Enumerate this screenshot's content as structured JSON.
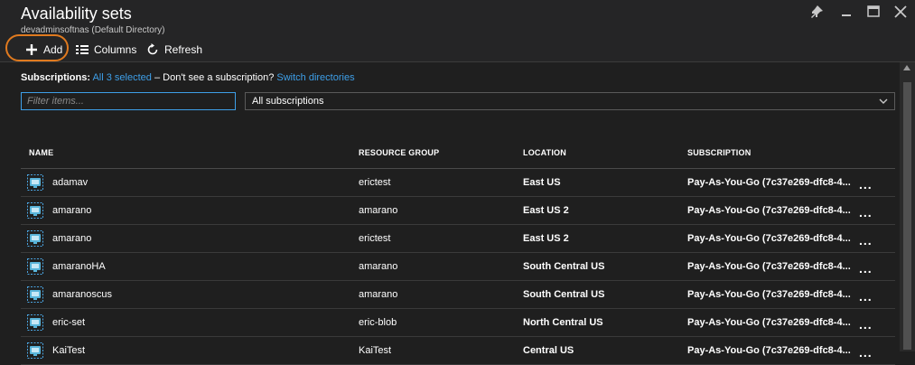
{
  "blade": {
    "title": "Availability sets",
    "subtitle": "devadminsoftnas (Default Directory)"
  },
  "window_controls": [
    {
      "name": "pin-icon"
    },
    {
      "name": "minimize-icon"
    },
    {
      "name": "maximize-icon"
    },
    {
      "name": "close-icon"
    }
  ],
  "toolbar": {
    "add_label": "Add",
    "columns_label": "Columns",
    "refresh_label": "Refresh",
    "highlight_color": "#e07a1f"
  },
  "subscriptions": {
    "label": "Subscriptions:",
    "selected_link": "All 3 selected",
    "prompt": "– Don't see a subscription?",
    "switch_link": "Switch directories"
  },
  "filter": {
    "placeholder": "Filter items...",
    "value": ""
  },
  "subscription_select": {
    "selected": "All subscriptions"
  },
  "table": {
    "columns": [
      "NAME",
      "RESOURCE GROUP",
      "LOCATION",
      "SUBSCRIPTION"
    ],
    "rows": [
      {
        "name": "adamav",
        "resource_group": "erictest",
        "location": "East US",
        "subscription": "Pay-As-You-Go (7c37e269-dfc8-4..."
      },
      {
        "name": "amarano",
        "resource_group": "amarano",
        "location": "East US 2",
        "subscription": "Pay-As-You-Go (7c37e269-dfc8-4..."
      },
      {
        "name": "amarano",
        "resource_group": "erictest",
        "location": "East US 2",
        "subscription": "Pay-As-You-Go (7c37e269-dfc8-4..."
      },
      {
        "name": "amaranoHA",
        "resource_group": "amarano",
        "location": "South Central US",
        "subscription": "Pay-As-You-Go (7c37e269-dfc8-4..."
      },
      {
        "name": "amaranoscus",
        "resource_group": "amarano",
        "location": "South Central US",
        "subscription": "Pay-As-You-Go (7c37e269-dfc8-4..."
      },
      {
        "name": "eric-set",
        "resource_group": "eric-blob",
        "location": "North Central US",
        "subscription": "Pay-As-You-Go (7c37e269-dfc8-4..."
      },
      {
        "name": "KaiTest",
        "resource_group": "KaiTest",
        "location": "Central US",
        "subscription": "Pay-As-You-Go (7c37e269-dfc8-4..."
      }
    ],
    "more_label": "...",
    "row_icon": "availability-set-icon"
  },
  "colors": {
    "background": "#1f1f1f",
    "link": "#3e9fe8",
    "accent_ring": "#e07a1f"
  }
}
